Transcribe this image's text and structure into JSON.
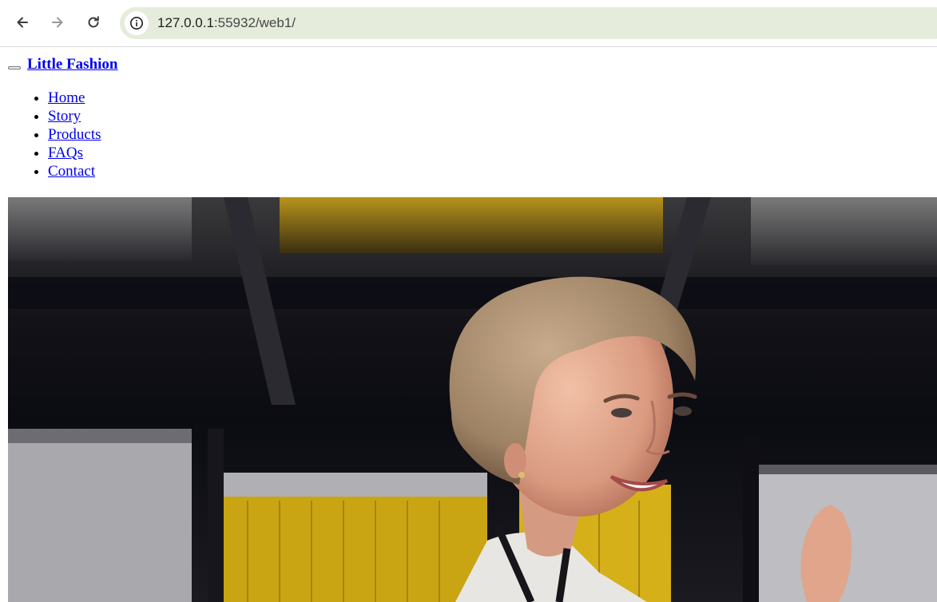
{
  "browser": {
    "url_host": "127.0.0.1",
    "url_path": ":55932/web1/",
    "icons": [
      "back-arrow-icon",
      "forward-arrow-icon",
      "reload-icon",
      "site-info-icon"
    ]
  },
  "site": {
    "brand": "Little Fashion",
    "nav": [
      {
        "label": "Home"
      },
      {
        "label": "Story"
      },
      {
        "label": "Products"
      },
      {
        "label": "FAQs"
      },
      {
        "label": "Contact"
      }
    ]
  },
  "colors": {
    "link": "#0000ee",
    "omnibox": "#e6ecdc"
  }
}
